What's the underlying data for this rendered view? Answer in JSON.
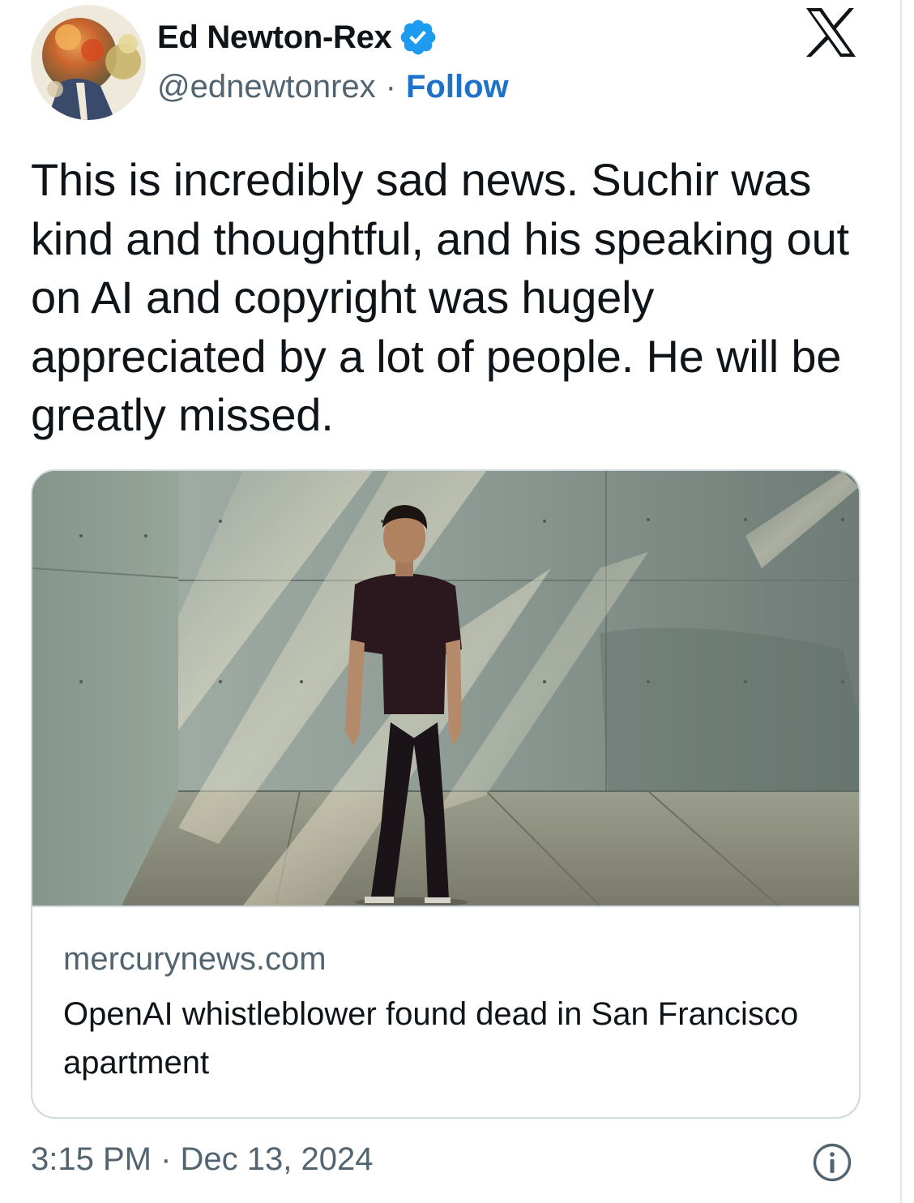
{
  "author": {
    "display_name": "Ed Newton-Rex",
    "handle": "@ednewtonrex",
    "separator": "·",
    "follow_label": "Follow",
    "verified": true
  },
  "tweet": {
    "text": "This is incredibly sad news. Suchir was kind and thoughtful, and his speaking out on AI and copyright was hugely appreciated by a lot of people. He will be greatly missed."
  },
  "link_card": {
    "domain": "mercurynews.com",
    "title": "OpenAI whistleblower found dead in San Francisco apartment"
  },
  "footer": {
    "timestamp": "3:15 PM · Dec 13, 2024"
  },
  "icons": {
    "brand": "x-logo-icon",
    "verified": "verified-badge-icon",
    "info": "info-icon"
  },
  "colors": {
    "text": "#0f1419",
    "secondary": "#536471",
    "link": "#1d72c9",
    "verified": "#1d9bf0",
    "border": "#cfd9de"
  }
}
